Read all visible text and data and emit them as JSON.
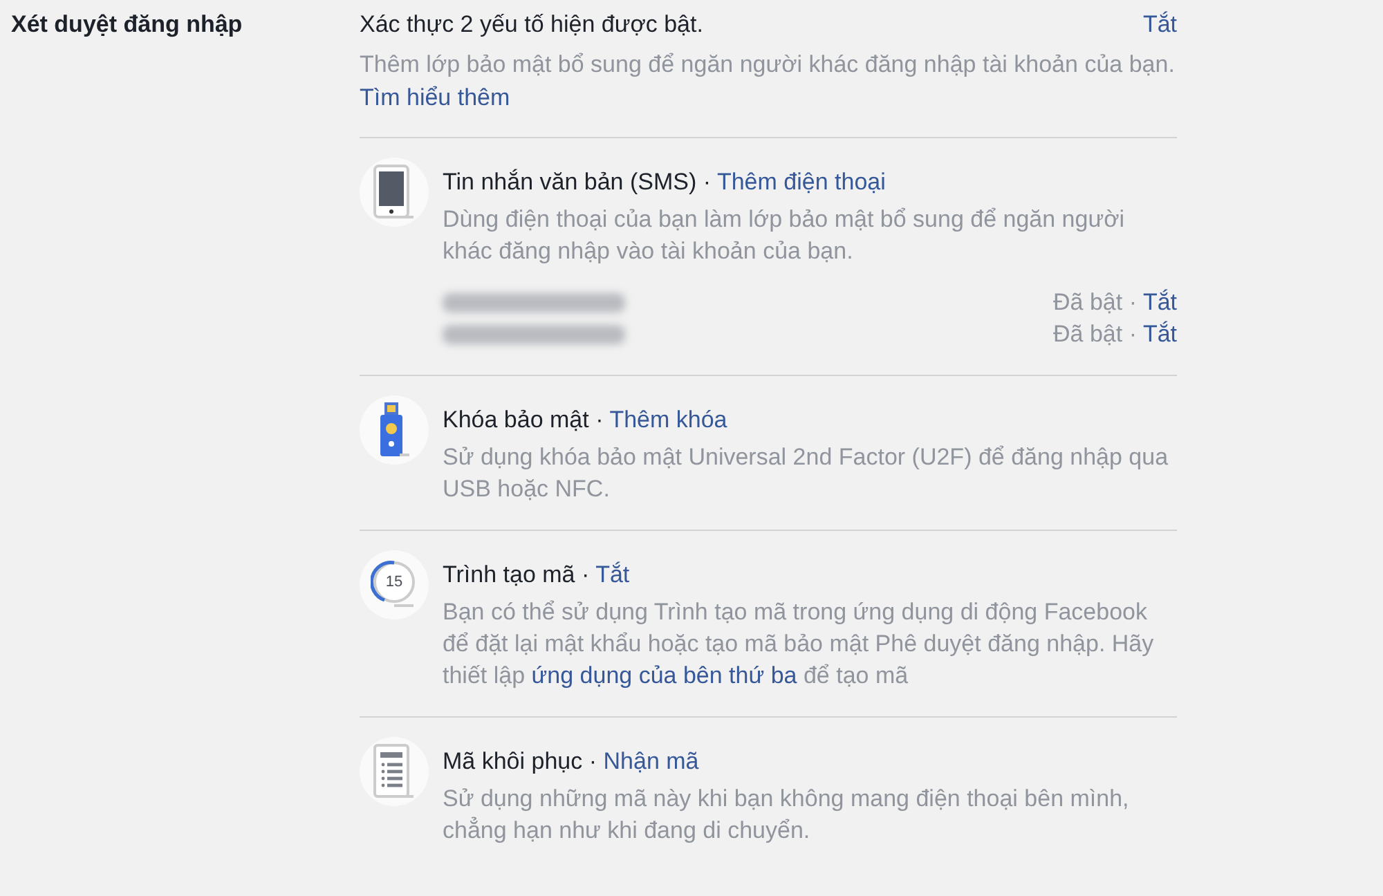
{
  "section_label": "Xét duyệt đăng nhập",
  "status": {
    "text": "Xác thực 2 yếu tố hiện được bật.",
    "action": "Tắt"
  },
  "intro": [
    {
      "kind": "text",
      "text": "Thêm lớp bảo mật bổ sung để ngăn người khác đăng nhập tài khoản của bạn. "
    },
    {
      "kind": "link",
      "text": "Tìm hiểu thêm"
    }
  ],
  "methods": [
    {
      "kind": "phone",
      "title": "Tin nhắn văn bản (SMS)",
      "separator": "·",
      "action": "Thêm điện thoại",
      "description": [
        {
          "kind": "text",
          "text": "Dùng điện thoại của bạn làm lớp bảo mật bổ sung để ngăn người khác đăng nhập vào tài khoản của bạn."
        }
      ],
      "phones": [
        {
          "status": "Đã bật",
          "separator": "·",
          "action": "Tắt"
        },
        {
          "status": "Đã bật",
          "separator": "·",
          "action": "Tắt"
        }
      ]
    },
    {
      "kind": "key",
      "title": "Khóa bảo mật",
      "separator": "·",
      "action": "Thêm khóa",
      "description": [
        {
          "kind": "text",
          "text": "Sử dụng khóa bảo mật Universal 2nd Factor (U2F) để đăng nhập qua USB hoặc NFC."
        }
      ]
    },
    {
      "kind": "generator",
      "title": "Trình tạo mã",
      "separator": "·",
      "action": "Tắt",
      "icon_text": "15",
      "description": [
        {
          "kind": "text",
          "text": "Bạn có thể sử dụng Trình tạo mã trong ứng dụng di động Facebook để đặt lại mật khẩu hoặc tạo mã bảo mật Phê duyệt đăng nhập. Hãy thiết lập "
        },
        {
          "kind": "link",
          "text": "ứng dụng của bên thứ ba"
        },
        {
          "kind": "text",
          "text": " để tạo mã"
        }
      ]
    },
    {
      "kind": "codes",
      "title": "Mã khôi phục",
      "separator": "·",
      "action": "Nhận mã",
      "description": [
        {
          "kind": "text",
          "text": "Sử dụng những mã này khi bạn không mang điện thoại bên mình, chẳng hạn như khi đang di chuyển."
        }
      ]
    }
  ]
}
